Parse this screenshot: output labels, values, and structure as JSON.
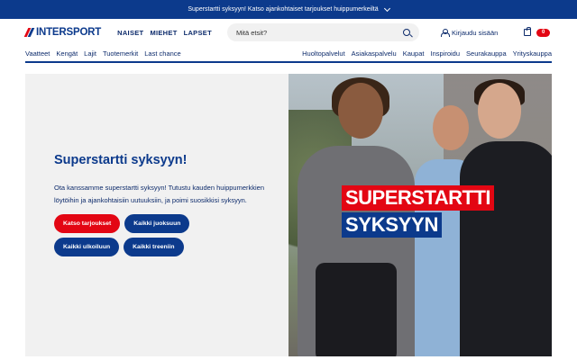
{
  "promo_bar": {
    "text": "Superstartti syksyyn! Katso ajankohtaiset tarjoukset huippumerkeiltä"
  },
  "header": {
    "logo_text": "INTERSPORT",
    "gender_nav": [
      "NAISET",
      "MIEHET",
      "LAPSET"
    ],
    "search_placeholder": "Mitä etsit?",
    "login_label": "Kirjaudu sisään",
    "cart_count": "0"
  },
  "subnav": {
    "left": [
      "Vaatteet",
      "Kengät",
      "Lajit",
      "Tuotemerkit",
      "Last chance"
    ],
    "right": [
      "Huoltopalvelut",
      "Asiakaspalvelu",
      "Kaupat",
      "Inspiroidu",
      "Seurakauppa",
      "Yrityskauppa"
    ]
  },
  "hero": {
    "title": "Superstartti syksyyn!",
    "body": "Ota kanssamme superstartti syksyyn! Tutustu kauden huippumerkkien löytöihin ja ajankohtaisiin uutuuksiin, ja poimi suosikkisi syksyyn.",
    "buttons": [
      "Katso tarjoukset",
      "Kaikki juoksuun",
      "Kaikki ulkoiluun",
      "Kaikki treeniin"
    ],
    "image_text_line1": "SUPERSTARTTI",
    "image_text_line2": "SYKSYYN"
  },
  "colors": {
    "brand_blue": "#0c3a8c",
    "brand_red": "#e30613",
    "hero_bg": "#f1f1f1"
  }
}
